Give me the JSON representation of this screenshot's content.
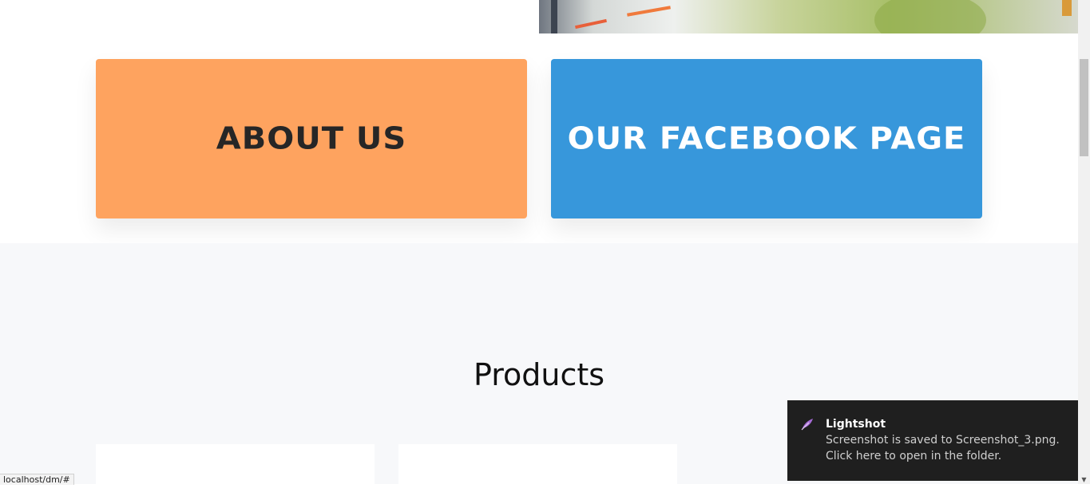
{
  "tiles": {
    "about_label": "ABOUT US",
    "facebook_label": "OUR FACEBOOK PAGE",
    "about_color": "#fea35f",
    "facebook_color": "#3797db"
  },
  "products": {
    "title": "Products"
  },
  "status_bar": {
    "url": "localhost/dm/#"
  },
  "toast": {
    "app_name": "Lightshot",
    "line1": "Screenshot is saved to Screenshot_3.png.",
    "line2": "Click here to open in the folder.",
    "icon": "feather-icon"
  }
}
